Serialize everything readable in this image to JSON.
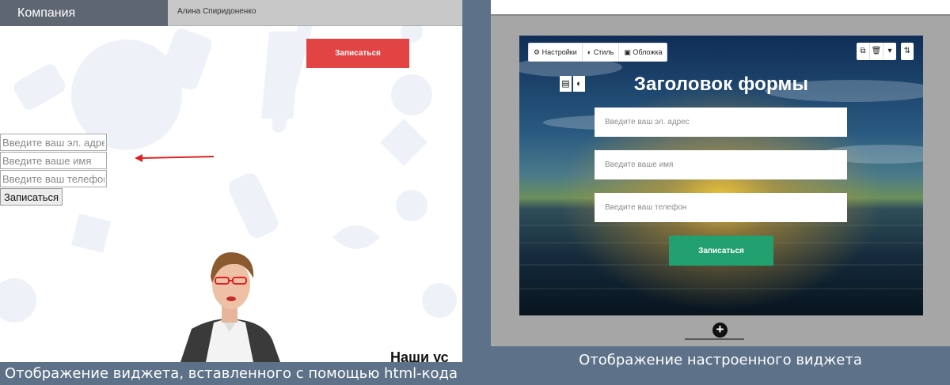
{
  "left": {
    "company": "Компания",
    "user_name": "Алина Спиридоненко",
    "cta_label": "Записаться",
    "form": {
      "email_placeholder": "Введите ваш эл. адрес",
      "name_placeholder": "Введите ваше имя",
      "phone_placeholder": "Введите ваш телефон",
      "submit_label": "Записаться"
    },
    "cut_heading": "Наши ус"
  },
  "right": {
    "toolbar": {
      "settings": "Настройки",
      "style": "Стиль",
      "cover": "Обложка"
    },
    "icons": {
      "settings": "⚙",
      "style": "◐",
      "cover": "▣",
      "copy": "⧉",
      "delete": "🗑",
      "more": "▾",
      "sort": "⇅",
      "form_icon": "▤",
      "contrast": "◐",
      "add": "+"
    },
    "form_title": "Заголовок формы",
    "email_placeholder": "Введите ваш эл. адрес",
    "name_placeholder": "Введите ваше имя",
    "phone_placeholder": "Введите ваш телефон",
    "submit_label": "Записаться"
  },
  "captions": {
    "left": "Отображение виджета, вставленного с помощью html-кода",
    "right": "Отображение настроенного виджета"
  },
  "colors": {
    "page_bg": "#5d7189",
    "left_cta": "#e24343",
    "right_submit": "#23a06f"
  }
}
